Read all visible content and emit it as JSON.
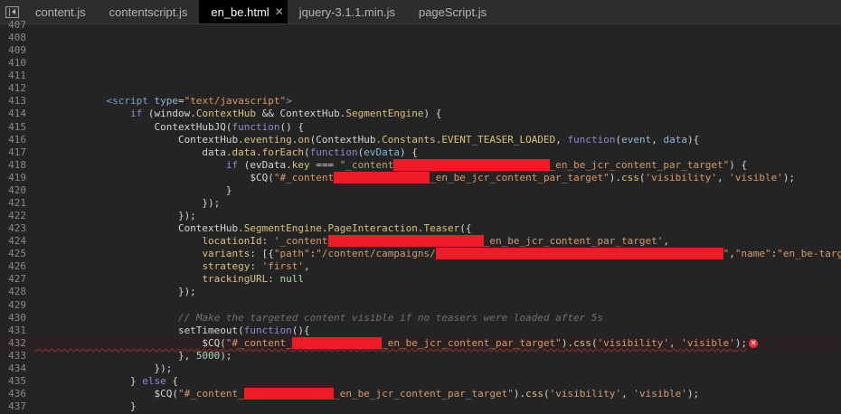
{
  "tabs": [
    {
      "label": "content.js",
      "active": false
    },
    {
      "label": "contentscript.js",
      "active": false
    },
    {
      "label": "en_be.html",
      "active": true
    },
    {
      "label": "jquery-3.1.1.min.js",
      "active": false
    },
    {
      "label": "pageScript.js",
      "active": false
    }
  ],
  "icons": {
    "sidebar_toggle": "panel-toggle-icon",
    "close": "close-icon",
    "error": "error-icon"
  },
  "colors": {
    "background": "#242424",
    "tabbar": "#2d2d2d",
    "active_tab": "#000000",
    "redaction": "#ee1c25",
    "error": "#e5323a"
  },
  "lines": [
    {
      "n": "407",
      "t": []
    },
    {
      "n": "408",
      "t": []
    },
    {
      "n": "409",
      "t": []
    },
    {
      "n": "410",
      "t": []
    },
    {
      "n": "411",
      "t": []
    },
    {
      "n": "412",
      "t": []
    },
    {
      "n": "413",
      "t": [
        [
          "pl",
          "            "
        ],
        [
          "tag",
          "<script "
        ],
        [
          "attr",
          "type"
        ],
        [
          "pl",
          "="
        ],
        [
          "str",
          "\"text/javascript\""
        ],
        [
          "tag",
          ">"
        ]
      ]
    },
    {
      "n": "414",
      "t": [
        [
          "pl",
          "                "
        ],
        [
          "kw",
          "if"
        ],
        [
          "pl",
          " (window."
        ],
        [
          "prop",
          "ContextHub"
        ],
        [
          "pl",
          " && ContextHub."
        ],
        [
          "prop",
          "SegmentEngine"
        ],
        [
          "pl",
          ") {"
        ]
      ]
    },
    {
      "n": "415",
      "t": [
        [
          "pl",
          "                    ContextHubJQ("
        ],
        [
          "kw",
          "function"
        ],
        [
          "pl",
          "() {"
        ]
      ]
    },
    {
      "n": "416",
      "t": [
        [
          "pl",
          "                        ContextHub."
        ],
        [
          "prop",
          "eventing"
        ],
        [
          "pl",
          "."
        ],
        [
          "prop",
          "on"
        ],
        [
          "pl",
          "(ContextHub."
        ],
        [
          "prop",
          "Constants"
        ],
        [
          "pl",
          "."
        ],
        [
          "prop",
          "EVENT_TEASER_LOADED"
        ],
        [
          "pl",
          ", "
        ],
        [
          "kw",
          "function"
        ],
        [
          "pl",
          "("
        ],
        [
          "par",
          "event"
        ],
        [
          "pl",
          ", "
        ],
        [
          "par",
          "data"
        ],
        [
          "pl",
          "){"
        ]
      ]
    },
    {
      "n": "417",
      "t": [
        [
          "pl",
          "                            data."
        ],
        [
          "prop",
          "data"
        ],
        [
          "pl",
          "."
        ],
        [
          "prop",
          "forEach"
        ],
        [
          "pl",
          "("
        ],
        [
          "kw",
          "function"
        ],
        [
          "pl",
          "("
        ],
        [
          "par",
          "evData"
        ],
        [
          "pl",
          ") {"
        ]
      ]
    },
    {
      "n": "418",
      "t": [
        [
          "pl",
          "                                "
        ],
        [
          "kw",
          "if"
        ],
        [
          "pl",
          " (evData."
        ],
        [
          "prop",
          "key"
        ],
        [
          "pl",
          " === "
        ],
        [
          "str",
          "\"_content"
        ],
        [
          "x",
          "                          "
        ],
        [
          "str",
          "_en_be_jcr_content_par_target\""
        ],
        [
          "pl",
          ") {"
        ]
      ]
    },
    {
      "n": "419",
      "t": [
        [
          "pl",
          "                                    $CQ("
        ],
        [
          "str",
          "\"#_content"
        ],
        [
          "x",
          "                "
        ],
        [
          "str",
          "_en_be_jcr_content_par_target\""
        ],
        [
          "pl",
          ")."
        ],
        [
          "prop",
          "css"
        ],
        [
          "pl",
          "("
        ],
        [
          "str",
          "'visibility'"
        ],
        [
          "pl",
          ", "
        ],
        [
          "str",
          "'visible'"
        ],
        [
          "pl",
          ");"
        ]
      ]
    },
    {
      "n": "420",
      "t": [
        [
          "pl",
          "                                }"
        ]
      ]
    },
    {
      "n": "421",
      "t": [
        [
          "pl",
          "                            });"
        ]
      ]
    },
    {
      "n": "422",
      "t": [
        [
          "pl",
          "                        });"
        ]
      ]
    },
    {
      "n": "423",
      "t": [
        [
          "pl",
          "                        ContextHub."
        ],
        [
          "prop",
          "SegmentEngine"
        ],
        [
          "pl",
          "."
        ],
        [
          "prop",
          "PageInteraction"
        ],
        [
          "pl",
          "."
        ],
        [
          "prop",
          "Teaser"
        ],
        [
          "pl",
          "({"
        ]
      ]
    },
    {
      "n": "424",
      "t": [
        [
          "pl",
          "                            "
        ],
        [
          "prop",
          "locationId"
        ],
        [
          "pl",
          ": "
        ],
        [
          "str",
          "'_content"
        ],
        [
          "x",
          "                          "
        ],
        [
          "str",
          "_en_be_jcr_content_par_target'"
        ],
        [
          "pl",
          ","
        ]
      ]
    },
    {
      "n": "425",
      "t": [
        [
          "pl",
          "                            "
        ],
        [
          "prop",
          "variants"
        ],
        [
          "pl",
          ": [{"
        ],
        [
          "str",
          "\"path\""
        ],
        [
          "pl",
          ":"
        ],
        [
          "str",
          "\"/content/campaigns/"
        ],
        [
          "x",
          "                                                "
        ],
        [
          "str",
          "\""
        ],
        [
          "pl",
          ","
        ],
        [
          "str",
          "\"name\""
        ],
        [
          "pl",
          ":"
        ],
        [
          "str",
          "\"en_be-target"
        ]
      ]
    },
    {
      "n": "426",
      "t": [
        [
          "pl",
          "                            "
        ],
        [
          "prop",
          "strategy"
        ],
        [
          "pl",
          ": "
        ],
        [
          "str",
          "'first'"
        ],
        [
          "pl",
          ","
        ]
      ]
    },
    {
      "n": "427",
      "t": [
        [
          "pl",
          "                            "
        ],
        [
          "prop",
          "trackingURL"
        ],
        [
          "pl",
          ": "
        ],
        [
          "num",
          "null"
        ]
      ]
    },
    {
      "n": "428",
      "t": [
        [
          "pl",
          "                        });"
        ]
      ]
    },
    {
      "n": "429",
      "t": []
    },
    {
      "n": "430",
      "t": [
        [
          "pl",
          "                        "
        ],
        [
          "com",
          "// Make the targeted content visible if no teasers were loaded after 5s"
        ]
      ]
    },
    {
      "n": "431",
      "t": [
        [
          "pl",
          "                        setTimeout("
        ],
        [
          "kw",
          "function"
        ],
        [
          "pl",
          "(){"
        ]
      ]
    },
    {
      "n": "432",
      "err": true,
      "t": [
        [
          "pl",
          "                            $CQ("
        ],
        [
          "str",
          "\"#_content_"
        ],
        [
          "x",
          "               "
        ],
        [
          "str",
          "_en_be_jcr_content_par_target\""
        ],
        [
          "pl",
          ")."
        ],
        [
          "prop",
          "css"
        ],
        [
          "pl",
          "("
        ],
        [
          "str",
          "'visibility'"
        ],
        [
          "pl",
          ", "
        ],
        [
          "str",
          "'visible'"
        ],
        [
          "pl",
          ");"
        ]
      ]
    },
    {
      "n": "433",
      "t": [
        [
          "pl",
          "                        }, "
        ],
        [
          "num",
          "5000"
        ],
        [
          "pl",
          ");"
        ]
      ]
    },
    {
      "n": "434",
      "t": [
        [
          "pl",
          "                    });"
        ]
      ]
    },
    {
      "n": "435",
      "t": [
        [
          "pl",
          "                } "
        ],
        [
          "kw",
          "else"
        ],
        [
          "pl",
          " {"
        ]
      ]
    },
    {
      "n": "436",
      "t": [
        [
          "pl",
          "                    $CQ("
        ],
        [
          "str",
          "\"#_content_"
        ],
        [
          "x",
          "               "
        ],
        [
          "str",
          "_en_be_jcr_content_par_target\""
        ],
        [
          "pl",
          ")."
        ],
        [
          "prop",
          "css"
        ],
        [
          "pl",
          "("
        ],
        [
          "str",
          "'visibility'"
        ],
        [
          "pl",
          ", "
        ],
        [
          "str",
          "'visible'"
        ],
        [
          "pl",
          ");"
        ]
      ]
    },
    {
      "n": "437",
      "t": [
        [
          "pl",
          "                }"
        ]
      ]
    }
  ]
}
